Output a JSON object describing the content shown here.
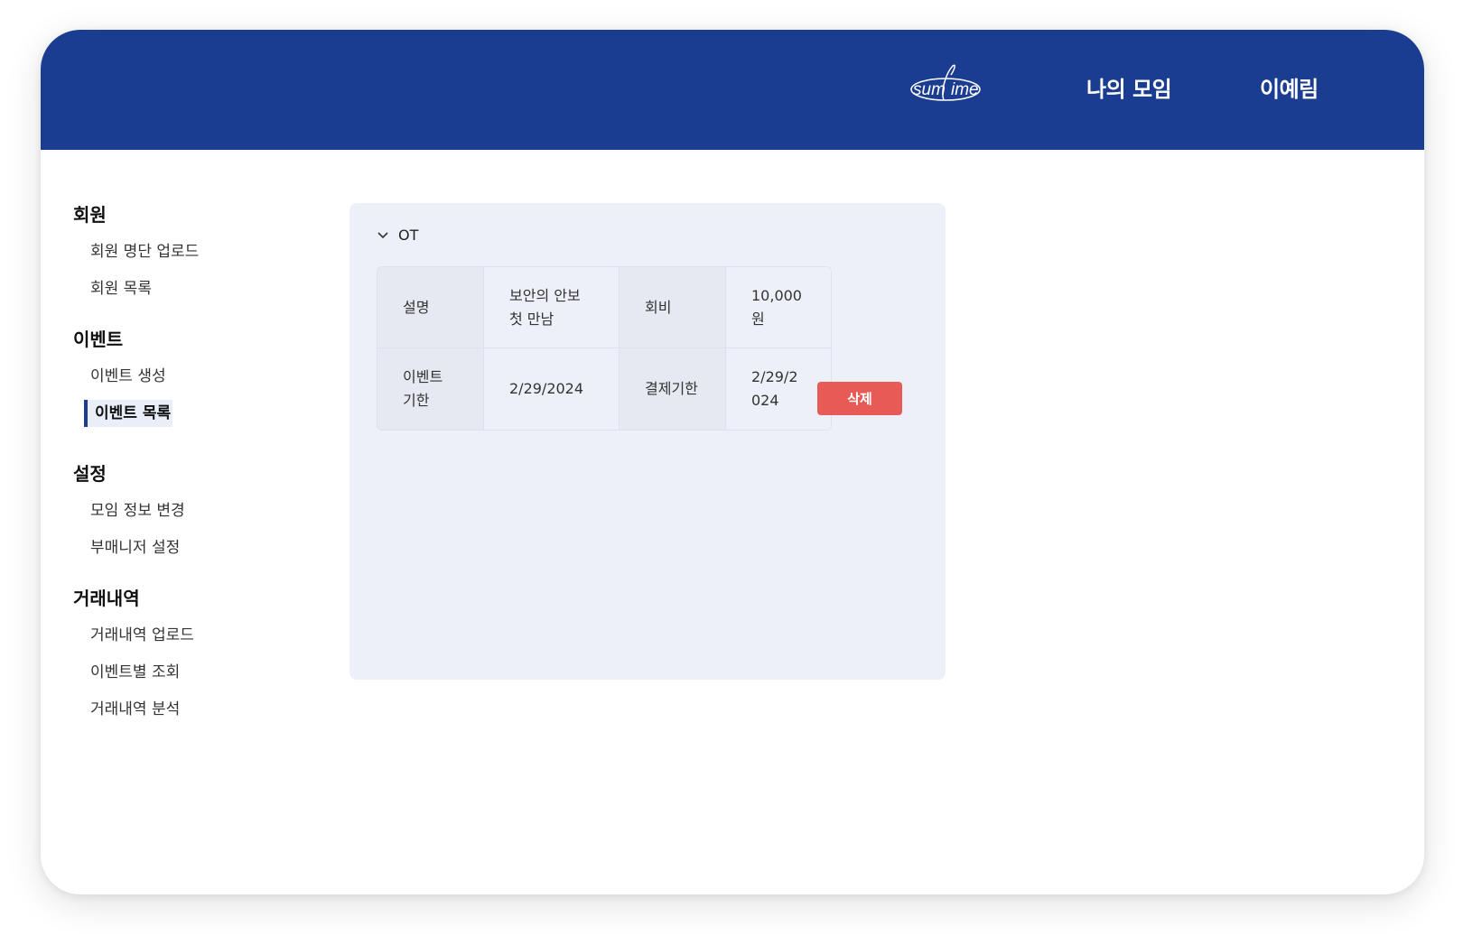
{
  "header": {
    "logo_text": "sumtime",
    "nav_my_meetings": "나의 모임",
    "nav_user": "이예림",
    "bg_color": "#1a3d91"
  },
  "sidebar": {
    "sections": [
      {
        "title": "회원",
        "items": [
          "회원 명단 업로드",
          "회원 목록"
        ]
      },
      {
        "title": "이벤트",
        "items": [
          "이벤트 생성",
          "이벤트 목록"
        ]
      },
      {
        "title": "설정",
        "items": [
          "모임 정보 변경",
          "부매니저 설정"
        ]
      },
      {
        "title": "거래내역",
        "items": [
          "거래내역 업로드",
          "이벤트별 조회",
          "거래내역 분석"
        ]
      }
    ],
    "active_item": "이벤트 목록"
  },
  "event": {
    "name": "OT",
    "expand_icon": "chevron-down-icon",
    "description_label": "설명",
    "description_value": "보안의 안보 첫 만남",
    "fee_label": "회비",
    "fee_value": "10,000원",
    "deadline_label": "이벤트 기한",
    "deadline_value": "2/29/2024",
    "payment_deadline_label": "결제기한",
    "payment_deadline_value": "2/29/2024",
    "delete_label": "삭제",
    "delete_color": "#e85a55"
  }
}
